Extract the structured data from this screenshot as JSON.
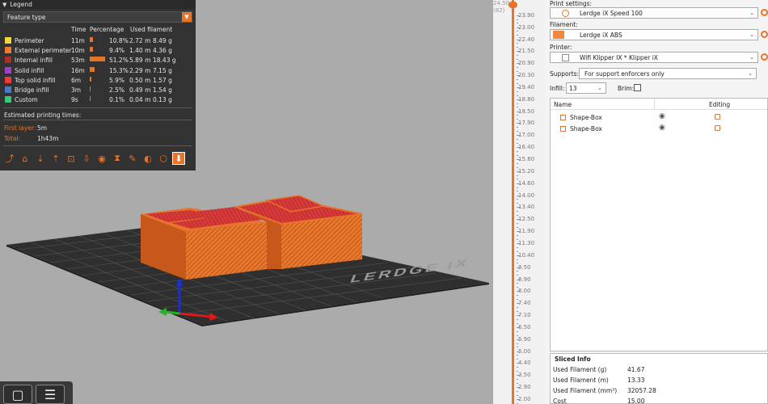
{
  "legend": {
    "title": "Legend",
    "view_type": "Feature type",
    "headers": {
      "time": "Time",
      "percentage": "Percentage",
      "used_filament": "Used filament"
    },
    "features": [
      {
        "name": "Perimeter",
        "time": "11m",
        "percent": "10.8%",
        "meters": "2.72 m",
        "grams": "8.49 g",
        "color": "#f0d83a",
        "fraction": 0.108
      },
      {
        "name": "External perimeter",
        "time": "10m",
        "percent": "9.4%",
        "meters": "1.40 m",
        "grams": "4.36 g",
        "color": "#f07830",
        "fraction": 0.094
      },
      {
        "name": "Internal infill",
        "time": "53m",
        "percent": "51.2%",
        "meters": "5.89 m",
        "grams": "18.43 g",
        "color": "#b02a28",
        "fraction": 0.512
      },
      {
        "name": "Solid infill",
        "time": "16m",
        "percent": "15.3%",
        "meters": "2.29 m",
        "grams": "7.15 g",
        "color": "#a040c8",
        "fraction": 0.153
      },
      {
        "name": "Top solid infill",
        "time": "6m",
        "percent": "5.9%",
        "meters": "0.50 m",
        "grams": "1.57 g",
        "color": "#f03838",
        "fraction": 0.059
      },
      {
        "name": "Bridge infill",
        "time": "3m",
        "percent": "2.5%",
        "meters": "0.49 m",
        "grams": "1.54 g",
        "color": "#4a78c8",
        "fraction": 0.025
      },
      {
        "name": "Custom",
        "time": "9s",
        "percent": "0.1%",
        "meters": "0.04 m",
        "grams": "0.13 g",
        "color": "#38c878",
        "fraction": 0.001
      }
    ],
    "estimated_title": "Estimated printing times:",
    "first_layer_label": "First layer:",
    "first_layer_value": "5m",
    "total_label": "Total:",
    "total_value": "1h43m"
  },
  "toolbar_icons": [
    "travel-icon",
    "wipe-icon",
    "retractions-icon",
    "deretractions-icon",
    "seams-icon",
    "tool-changes-icon",
    "color-changes-icon",
    "pause-icon",
    "custom-gcode-icon",
    "center-of-gravity-icon",
    "shells-icon",
    "tool-marker-icon"
  ],
  "bed_label": "LERDGE IX",
  "layer_slider": {
    "top_value": "24.50",
    "top_layer": "(82)",
    "labels": [
      "24.50",
      "23.90",
      "23.00",
      "22.40",
      "21.50",
      "20.90",
      "20.30",
      "19.40",
      "18.80",
      "18.50",
      "17.90",
      "17.00",
      "16.40",
      "15.80",
      "15.20",
      "14.60",
      "14.00",
      "13.40",
      "12.50",
      "11.90",
      "11.30",
      "10.40",
      "9.50",
      "8.90",
      "8.00",
      "7.40",
      "7.10",
      "6.50",
      "5.90",
      "5.00",
      "4.40",
      "3.50",
      "2.90",
      "2.00"
    ]
  },
  "sidebar": {
    "print_settings_label": "Print settings:",
    "print_settings_value": "Lerdge iX Speed 100",
    "filament_label": "Filament:",
    "filament_value": "Lerdge iX ABS",
    "filament_color": "#f4873e",
    "printer_label": "Printer:",
    "printer_value": "Wifi Klipper IX * Klipper iX",
    "supports_label": "Supports:",
    "supports_value": "For support enforcers only",
    "infill_label": "Infill:",
    "infill_value": "13",
    "brim_label": "Brim:",
    "objects_header_name": "Name",
    "objects_header_editing": "Editing",
    "objects": [
      "Shape-Box",
      "Shape-Box"
    ]
  },
  "sliced_info": {
    "title": "Sliced Info",
    "rows": [
      {
        "label": "Used Filament (g)",
        "value": "41.67"
      },
      {
        "label": "Used Filament (m)",
        "value": "13.33"
      },
      {
        "label": "Used Filament (mm³)",
        "value": "32057.28"
      },
      {
        "label": "Cost",
        "value": "15.00"
      }
    ]
  }
}
